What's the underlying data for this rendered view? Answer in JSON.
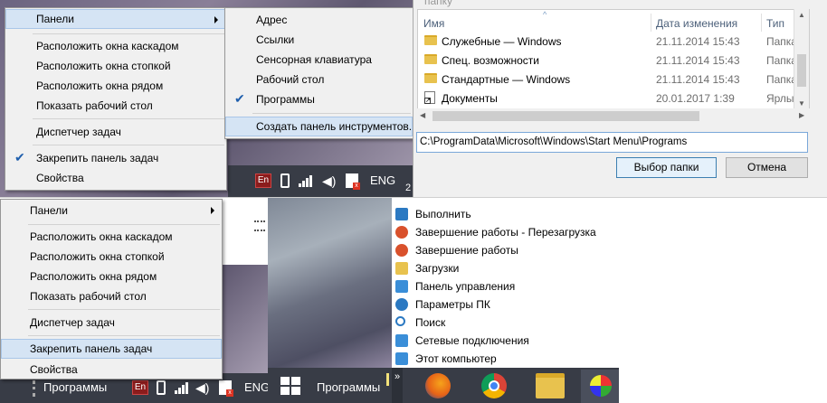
{
  "top_left_menu": {
    "items": [
      "Панели",
      "Расположить окна каскадом",
      "Расположить окна стопкой",
      "Расположить окна рядом",
      "Показать рабочий стол",
      "Диспетчер задач",
      "Закрепить панель задач",
      "Свойства"
    ]
  },
  "submenu": {
    "items": [
      "Адрес",
      "Ссылки",
      "Сенсорная клавиатура",
      "Рабочий стол",
      "Программы",
      "Создать панель инструментов..."
    ]
  },
  "top_tray": {
    "lang_badge": "En",
    "lang": "ENG",
    "clock_fragment": "2"
  },
  "dialog": {
    "title_fragment": "папку",
    "columns": {
      "name": "Имя",
      "date": "Дата изменения",
      "type": "Тип"
    },
    "rows": [
      {
        "name": "Служебные — Windows",
        "date": "21.11.2014 15:43",
        "type": "Папка с ф"
      },
      {
        "name": "Спец. возможности",
        "date": "21.11.2014 15:43",
        "type": "Папка с ф"
      },
      {
        "name": "Стандартные — Windows",
        "date": "21.11.2014 15:43",
        "type": "Папка с ф"
      },
      {
        "name": "Документы",
        "date": "20.01.2017 1:39",
        "type": "Ярлык"
      }
    ],
    "path_value": "C:\\ProgramData\\Microsoft\\Windows\\Start Menu\\Programs",
    "select_button": "Выбор папки",
    "cancel_button": "Отмена"
  },
  "bottom_left_menu": {
    "items": [
      "Панели",
      "Расположить окна каскадом",
      "Расположить окна стопкой",
      "Расположить окна рядом",
      "Показать рабочий стол",
      "Диспетчер задач",
      "Закрепить панель задач",
      "Свойства"
    ]
  },
  "bottom_taskbar_left": {
    "programs_label": "Программы",
    "lang_badge": "En",
    "lang": "ENG"
  },
  "start_list": {
    "items": [
      {
        "label": "Выполнить",
        "icon": "run-icon",
        "color": "#2b79c2"
      },
      {
        "label": "Завершение работы - Перезагрузка",
        "icon": "power-icon",
        "color": "#d9512c"
      },
      {
        "label": "Завершение работы",
        "icon": "power-icon",
        "color": "#d9512c"
      },
      {
        "label": "Загрузки",
        "icon": "downloads-folder-icon",
        "color": "#e8c24e"
      },
      {
        "label": "Панель управления",
        "icon": "control-panel-icon",
        "color": "#3a8ed8"
      },
      {
        "label": "Параметры ПК",
        "icon": "gear-icon",
        "color": "#2b79c2"
      },
      {
        "label": "Поиск",
        "icon": "search-icon",
        "color": "#2b79c2"
      },
      {
        "label": "Сетевые подключения",
        "icon": "network-icon",
        "color": "#3a8ed8"
      },
      {
        "label": "Этот компьютер",
        "icon": "computer-icon",
        "color": "#3a8ed8"
      }
    ]
  },
  "bottom_taskbar_right": {
    "programs_label": "Программы",
    "chevron": "»"
  }
}
